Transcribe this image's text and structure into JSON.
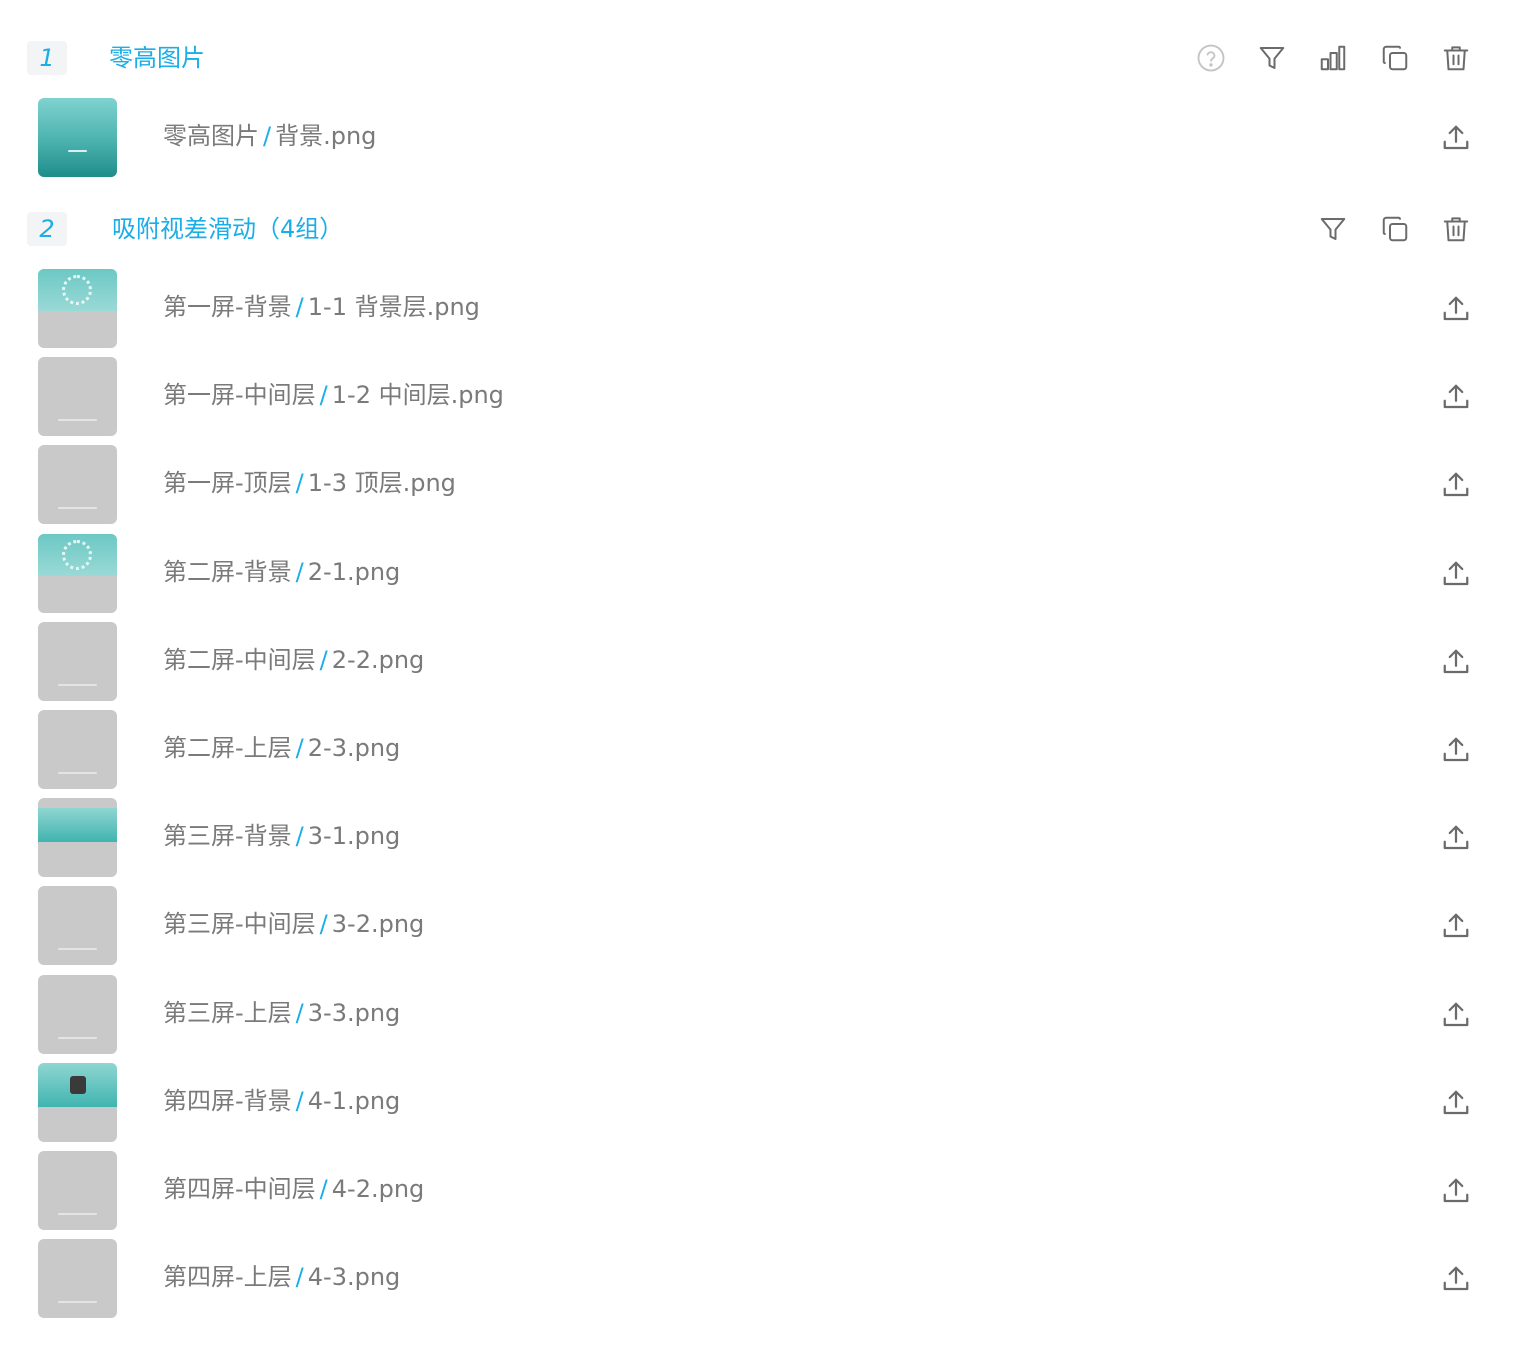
{
  "groups": [
    {
      "index": "1",
      "title": "零高图片",
      "actions": [
        "help-icon",
        "filter-icon",
        "chart-icon",
        "copy-icon",
        "trash-icon"
      ],
      "items": [
        {
          "folder": "零高图片",
          "separator": "/",
          "file": "背景.png",
          "thumb": "teal-full"
        }
      ]
    },
    {
      "index": "2",
      "title": "吸附视差滑动（4组）",
      "actions": [
        "filter-icon",
        "copy-icon",
        "trash-icon"
      ],
      "items": [
        {
          "folder": "第一屏-背景",
          "separator": "/",
          "file": "1-1 背景层.png",
          "thumb": "teal-dots"
        },
        {
          "folder": "第一屏-中间层",
          "separator": "/",
          "file": "1-2 中间层.png",
          "thumb": "grey"
        },
        {
          "folder": "第一屏-顶层",
          "separator": "/",
          "file": "1-3 顶层.png",
          "thumb": "grey"
        },
        {
          "folder": "第二屏-背景",
          "separator": "/",
          "file": "2-1.png",
          "thumb": "teal-dots"
        },
        {
          "folder": "第二屏-中间层",
          "separator": "/",
          "file": "2-2.png",
          "thumb": "grey"
        },
        {
          "folder": "第二屏-上层",
          "separator": "/",
          "file": "2-3.png",
          "thumb": "grey"
        },
        {
          "folder": "第三屏-背景",
          "separator": "/",
          "file": "3-1.png",
          "thumb": "teal-mid"
        },
        {
          "folder": "第三屏-中间层",
          "separator": "/",
          "file": "3-2.png",
          "thumb": "grey"
        },
        {
          "folder": "第三屏-上层",
          "separator": "/",
          "file": "3-3.png",
          "thumb": "grey"
        },
        {
          "folder": "第四屏-背景",
          "separator": "/",
          "file": "4-1.png",
          "thumb": "teal-box"
        },
        {
          "folder": "第四屏-中间层",
          "separator": "/",
          "file": "4-2.png",
          "thumb": "grey"
        },
        {
          "folder": "第四屏-上层",
          "separator": "/",
          "file": "4-3.png",
          "thumb": "grey"
        }
      ]
    }
  ],
  "colors": {
    "accent": "#1aaee8",
    "text": "#7a7a7a",
    "icon": "#6b6b6b",
    "icon_muted": "#c4c4c4",
    "badge_bg": "#f2f4f5"
  }
}
